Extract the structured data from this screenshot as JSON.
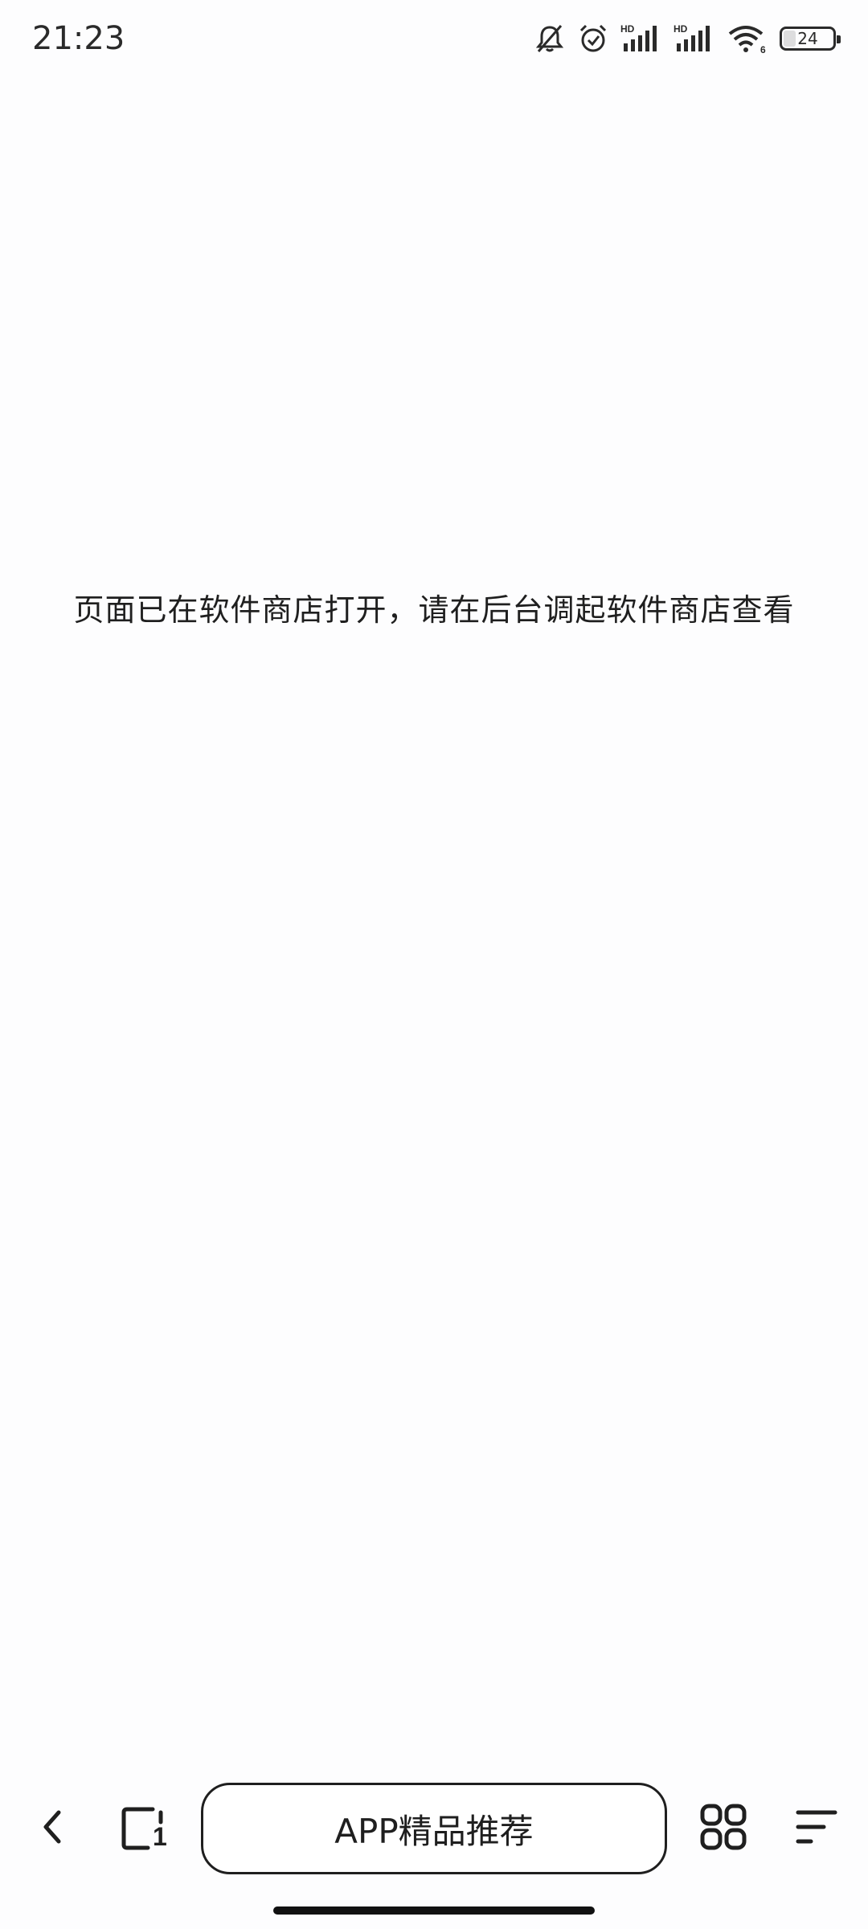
{
  "status_bar": {
    "time": "21:23",
    "network_label_1": "HD",
    "network_label_2": "HD",
    "wifi_label": "6",
    "battery": "24",
    "icons": [
      "bell-off-icon",
      "alarm-icon",
      "signal-icon",
      "signal-icon",
      "wifi-icon",
      "battery-icon"
    ]
  },
  "main": {
    "message": "页面已在软件商店打开，请在后台调起软件商店查看"
  },
  "toolbar": {
    "back_icon": "chevron-left-icon",
    "tabs_count": "1",
    "recommend_label": "APP精品推荐",
    "apps_icon": "grid-icon",
    "menu_icon": "menu-icon"
  }
}
